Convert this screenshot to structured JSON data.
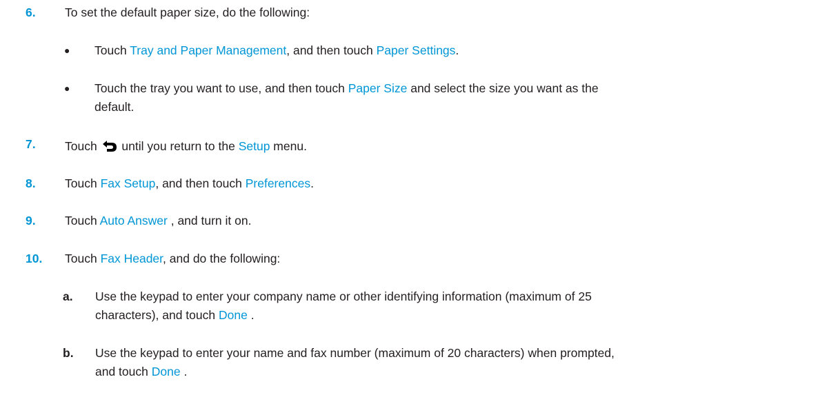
{
  "steps": [
    {
      "number": "6.",
      "parts": [
        "To set the default paper size, do the following:"
      ],
      "bullets": [
        {
          "symbol": "●",
          "t1": "Touch ",
          "l1": "Tray and Paper Management",
          "t2": ", and then touch ",
          "l2": "Paper Settings",
          "t3": "."
        },
        {
          "symbol": "●",
          "t1": "Touch the tray you want to use, and then touch ",
          "l1": "Paper Size",
          "t2": " and select the size you want as the",
          "line2": "default."
        }
      ]
    },
    {
      "number": "7.",
      "t1": "Touch ",
      "icon": "back-arrow-icon",
      "t2": " until you return to the ",
      "l1": "Setup",
      "t3": " menu."
    },
    {
      "number": "8.",
      "t1": "Touch ",
      "l1": "Fax Setup",
      "t2": ", and then touch ",
      "l2": "Preferences",
      "t3": "."
    },
    {
      "number": "9.",
      "t1": "Touch ",
      "l1": "Auto Answer",
      "t2": " , and turn it on."
    },
    {
      "number": "10.",
      "t1": "Touch ",
      "l1": "Fax Header",
      "t2": ", and do the following:",
      "substeps": [
        {
          "letter": "a.",
          "line1": "Use the keypad to enter your company name or other identifying information (maximum of 25",
          "t1": "characters), and touch ",
          "l1": "Done",
          "t2": " ."
        },
        {
          "letter": "b.",
          "line1": "Use the keypad to enter your name and fax number (maximum of 20 characters) when prompted,",
          "t1": "and touch ",
          "l1": "Done",
          "t2": " ."
        }
      ]
    }
  ],
  "colors": {
    "link": "#0096d6",
    "text": "#231f20"
  }
}
